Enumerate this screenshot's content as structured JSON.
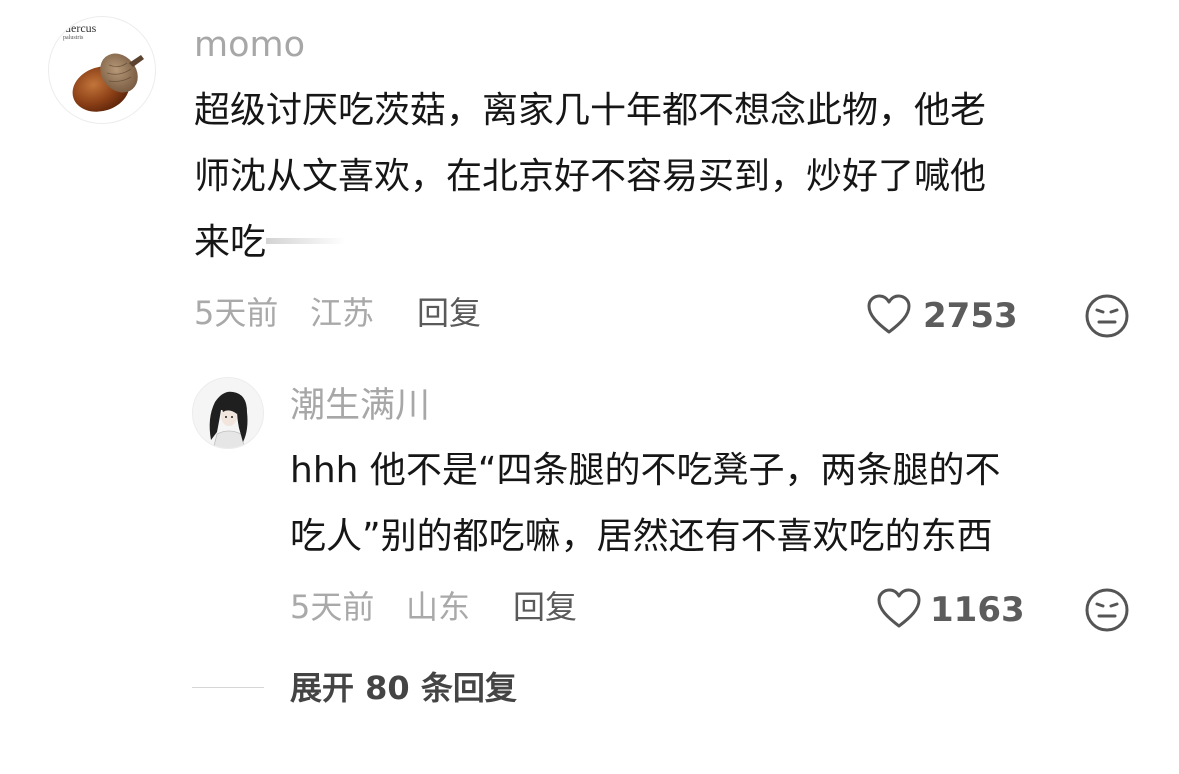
{
  "comment": {
    "username": "momo",
    "avatar_text": "uercus",
    "avatar_subtext": "palustris",
    "text_lines": [
      "超级讨厌吃茨菇，离家几十年都不想念此物，他老",
      "师沈从文喜欢，在北京好不容易买到，炒好了喊他",
      "来吃"
    ],
    "time": "5天前",
    "location": "江苏",
    "reply_label": "回复",
    "likes": "2753",
    "icons": [
      "heart-icon",
      "dislike-face-icon"
    ]
  },
  "reply": {
    "username": "潮生满川",
    "text_lines": [
      "hhh 他不是“四条腿的不吃凳子，两条腿的不",
      "吃人”别的都吃嘛，居然还有不喜欢吃的东西"
    ],
    "time": "5天前",
    "location": "山东",
    "reply_label": "回复",
    "likes": "1163",
    "icons": [
      "heart-icon",
      "dislike-face-icon"
    ]
  },
  "expand": {
    "label": "展开 80 条回复"
  },
  "colors": {
    "text": "#161616",
    "muted": "#a9a9a9",
    "icon": "#555555"
  }
}
